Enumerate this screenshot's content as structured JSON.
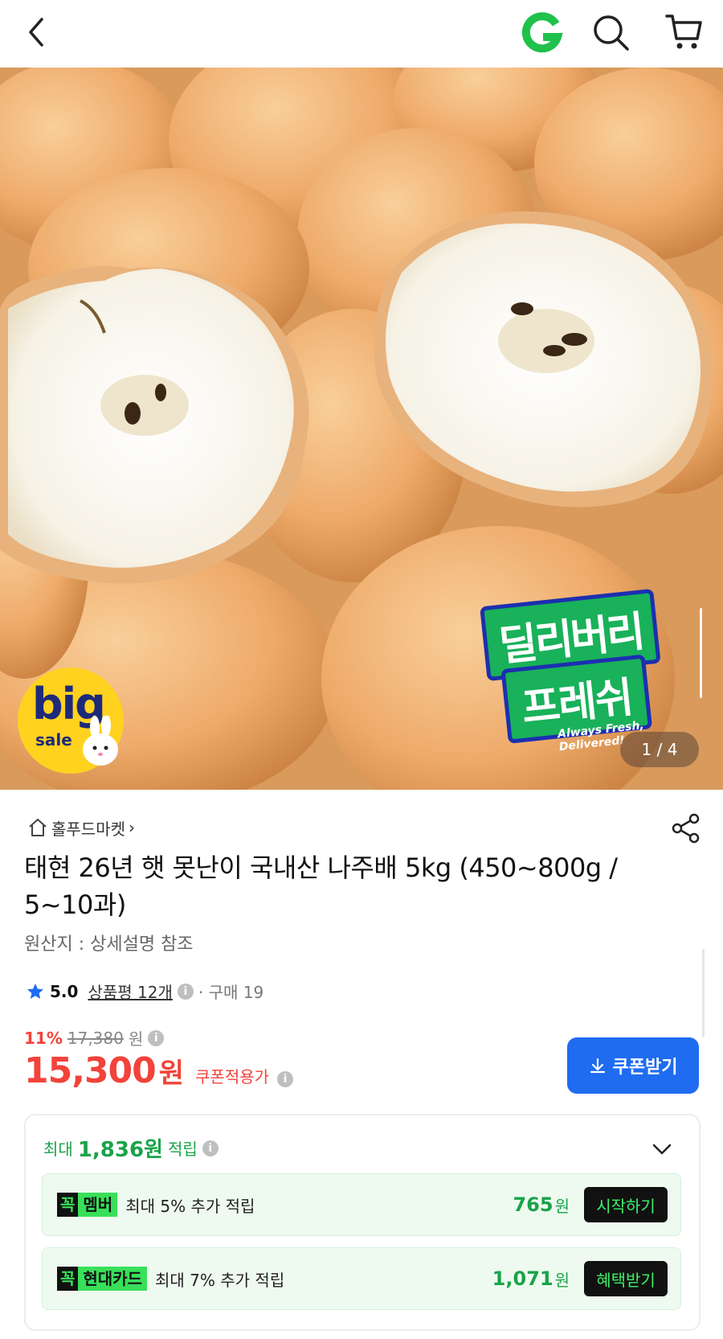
{
  "header": {
    "back_icon": "chevron-left-icon",
    "brand_icon": "g-logo-icon",
    "search_icon": "search-icon",
    "cart_icon": "cart-icon"
  },
  "hero": {
    "badge_big": "big",
    "badge_sale": "sale",
    "sticker_line1": "딜리버리",
    "sticker_line2": "프레쉬",
    "sticker_tag": "Always Fresh, Delivered!",
    "page_indicator": "1 / 4"
  },
  "product": {
    "store_name": "홀푸드마켓",
    "store_chevron": "›",
    "title": "태현 26년 햇 못난이 국내산 나주배 5kg (450~800g / 5~10과)",
    "origin": "원산지 : 상세설명 참조",
    "rating_score": "5.0",
    "review_label": "상품평 12개",
    "purchase_label": "· 구매 19",
    "discount_pct": "11%",
    "original_price": "17,380",
    "original_unit": "원",
    "price": "15,300",
    "price_unit": "원",
    "coupon_applied_label": "쿠폰적용가",
    "coupon_button": "쿠폰받기",
    "info_glyph": "i"
  },
  "reward": {
    "prefix": "최대",
    "amount": "1,836원",
    "suffix": "적립",
    "benefits": [
      {
        "tag_mark": "꼭",
        "tag_name": "멤버",
        "desc": "최대 5% 추가 적립",
        "value": "765",
        "unit": "원",
        "action": "시작하기"
      },
      {
        "tag_mark": "꼭",
        "tag_name": "현대카드",
        "desc": "최대 7% 추가 적립",
        "value": "1,071",
        "unit": "원",
        "action": "혜택받기"
      }
    ]
  },
  "colors": {
    "accent_red": "#f2433a",
    "accent_blue": "#1f6cf1",
    "accent_green": "#1aa34a",
    "brand_green": "#1fc14b"
  }
}
